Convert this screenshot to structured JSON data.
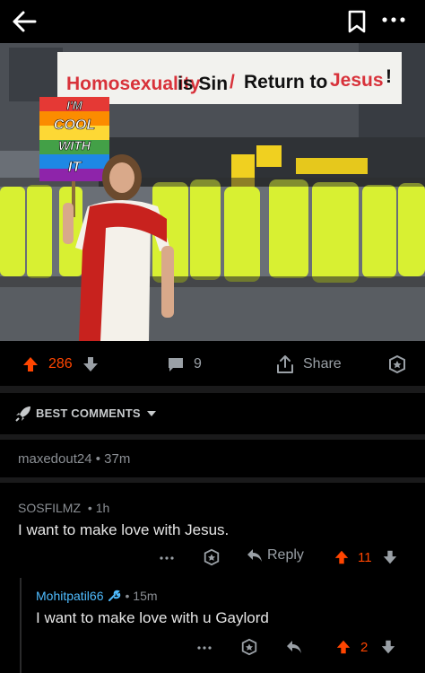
{
  "post": {
    "banner_text_part1": "Homosexuality",
    "banner_text_part2": "is Sin",
    "banner_text_part3": "Return to",
    "banner_text_part4": "Jesus",
    "sign_line1": "I'M",
    "sign_line2": "COOL",
    "sign_line3": "WITH",
    "sign_line4": "IT",
    "upvotes": "286",
    "comment_count": "9",
    "share_label": "Share"
  },
  "sort": {
    "label": "BEST COMMENTS"
  },
  "collapsed_comment": {
    "meta": "maxedout24 • 37m"
  },
  "comments": [
    {
      "author": "SOSFILMZ",
      "time": "• 1h",
      "body": "I want to make love with Jesus.",
      "reply_label": "Reply",
      "score": "11"
    },
    {
      "author": "Mohitpatil66",
      "time": "• 15m",
      "body": "I want to make love with u Gaylord",
      "score": "2"
    }
  ],
  "colors": {
    "upvote": "#ff4500",
    "author_link": "#4fbcff",
    "icon_gray": "#9aa0a6"
  }
}
